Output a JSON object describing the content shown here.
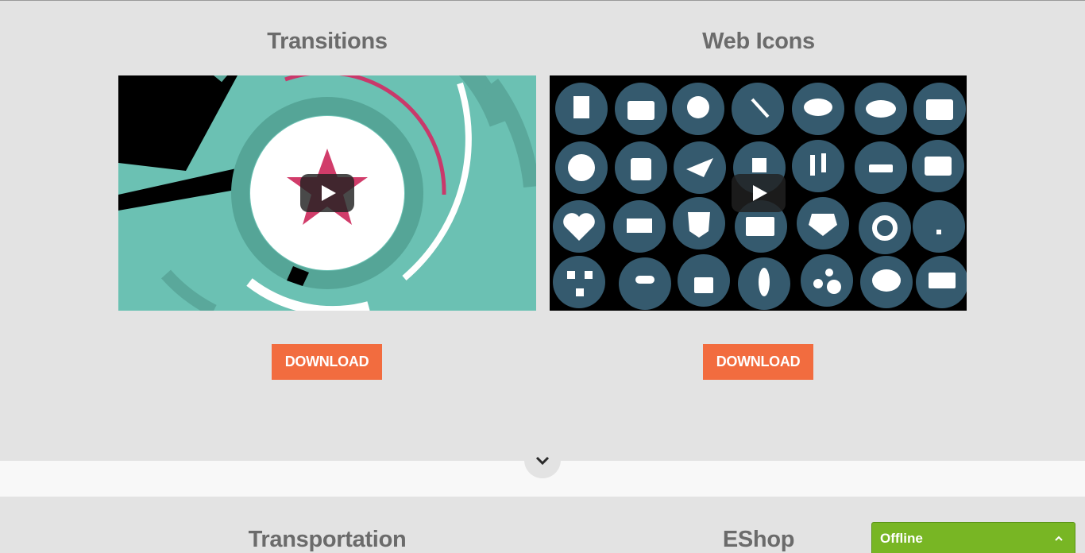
{
  "cards": [
    {
      "title": "Transitions",
      "download_label": "DOWNLOAD"
    },
    {
      "title": "Web Icons",
      "download_label": "DOWNLOAD"
    },
    {
      "title": "Transportation"
    },
    {
      "title": "EShop"
    }
  ],
  "chat": {
    "status": "Offline"
  },
  "colors": {
    "page_bg": "#e3e3e3",
    "band_bg": "#f8f8f8",
    "button": "#f26c3f",
    "chat_bar": "#78b624",
    "teal": "#6bc1b3",
    "icon_circle": "#355a6e"
  },
  "icons": {
    "scroll": "chevron-down-icon",
    "chat_toggle": "chevron-up-icon",
    "play": "play-icon"
  }
}
